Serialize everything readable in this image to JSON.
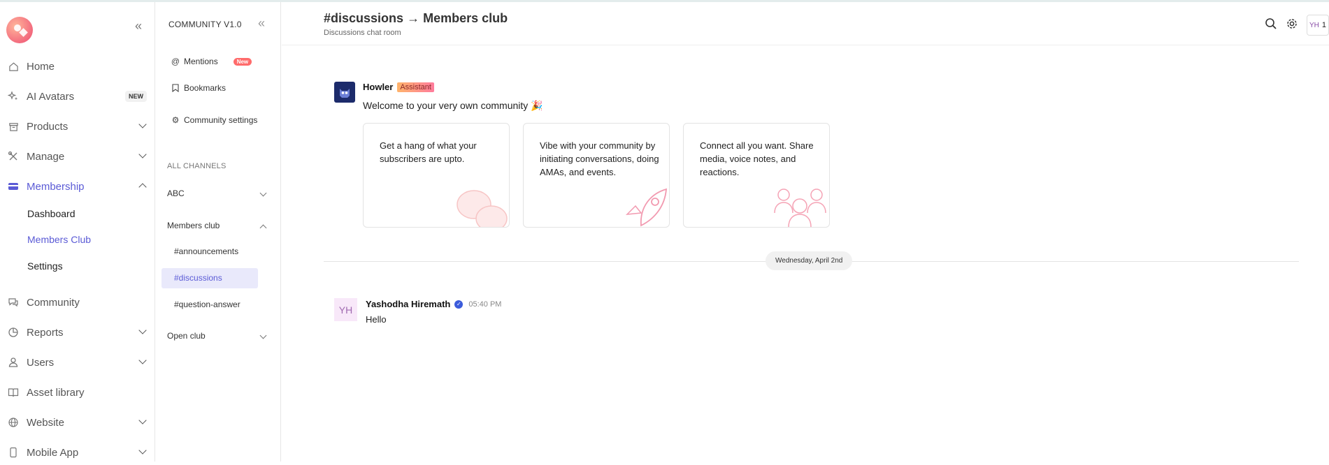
{
  "sidebar": {
    "items": [
      {
        "label": "Home",
        "icon": "home-icon"
      },
      {
        "label": "AI Avatars",
        "icon": "sparkle-icon",
        "badge": "NEW"
      },
      {
        "label": "Products",
        "icon": "box-icon"
      },
      {
        "label": "Manage",
        "icon": "tools-icon"
      },
      {
        "label": "Membership",
        "icon": "membership-icon"
      },
      {
        "label": "Community",
        "icon": "chat-icon"
      },
      {
        "label": "Reports",
        "icon": "pie-chart-icon"
      },
      {
        "label": "Users",
        "icon": "user-icon"
      },
      {
        "label": "Asset library",
        "icon": "book-icon"
      },
      {
        "label": "Website",
        "icon": "globe-icon"
      },
      {
        "label": "Mobile App",
        "icon": "mobile-icon"
      }
    ],
    "membership_sub": [
      "Dashboard",
      "Members Club",
      "Settings"
    ],
    "accent": "#5b5bd6"
  },
  "community": {
    "title": "COMMUNITY V1.0",
    "mentions": "Mentions",
    "mentions_badge": "New",
    "bookmarks": "Bookmarks",
    "settings": "Community settings",
    "section_label": "ALL CHANNELS",
    "groups": [
      "ABC",
      "Members club",
      "Open club"
    ],
    "channels": [
      "#announcements",
      "#discussions",
      "#question-answer"
    ]
  },
  "header": {
    "channel": "#discussions",
    "arrow": "→",
    "club": "Members club",
    "subtitle": "Discussions chat room",
    "user_initials": "YH",
    "count": "1"
  },
  "welcome": {
    "bot_name": "Howler",
    "bot_badge": "Assistant",
    "message": "Welcome to your very own community 🎉",
    "cards": [
      "Get a hang of what your subscribers are upto.",
      "Vibe with your community by initiating conversations, doing AMAs, and events.",
      "Connect all you want. Share media, voice notes, and reactions."
    ]
  },
  "date_divider": "Wednesday, April 2nd",
  "message": {
    "initials": "YH",
    "author": "Yashodha Hiremath",
    "time": "05:40 PM",
    "text": "Hello"
  }
}
